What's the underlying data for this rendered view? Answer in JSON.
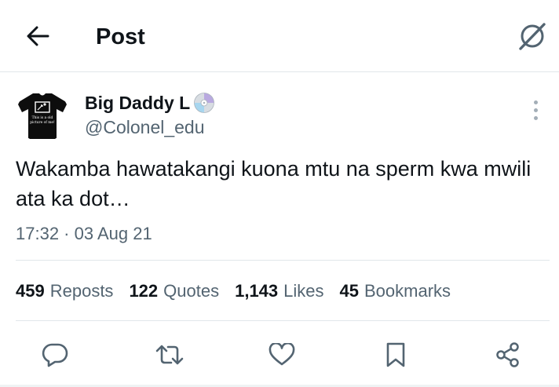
{
  "header": {
    "title": "Post",
    "back_icon": "arrow-left-icon",
    "grok_icon": "grok-icon"
  },
  "author": {
    "display_name": "Big Daddy L",
    "name_emoji": "cd-disc-emoji",
    "handle": "@Colonel_edu",
    "avatar": {
      "caption_line1": "This is a old",
      "caption_line2": "picture of me!"
    }
  },
  "tweet": {
    "text": "Wakamba hawatakangi kuona mtu na sperm kwa mwili ata ka dot…",
    "timestamp": "17:32 · 03 Aug 21"
  },
  "stats": [
    {
      "count": "459",
      "label": "Reposts"
    },
    {
      "count": "122",
      "label": "Quotes"
    },
    {
      "count": "1,143",
      "label": "Likes"
    },
    {
      "count": "45",
      "label": "Bookmarks"
    }
  ],
  "actions": [
    "reply-icon",
    "repost-icon",
    "like-icon",
    "bookmark-icon",
    "share-icon"
  ],
  "colors": {
    "text": "#0f1419",
    "secondary": "#536471",
    "divider": "#e1e6ea"
  }
}
